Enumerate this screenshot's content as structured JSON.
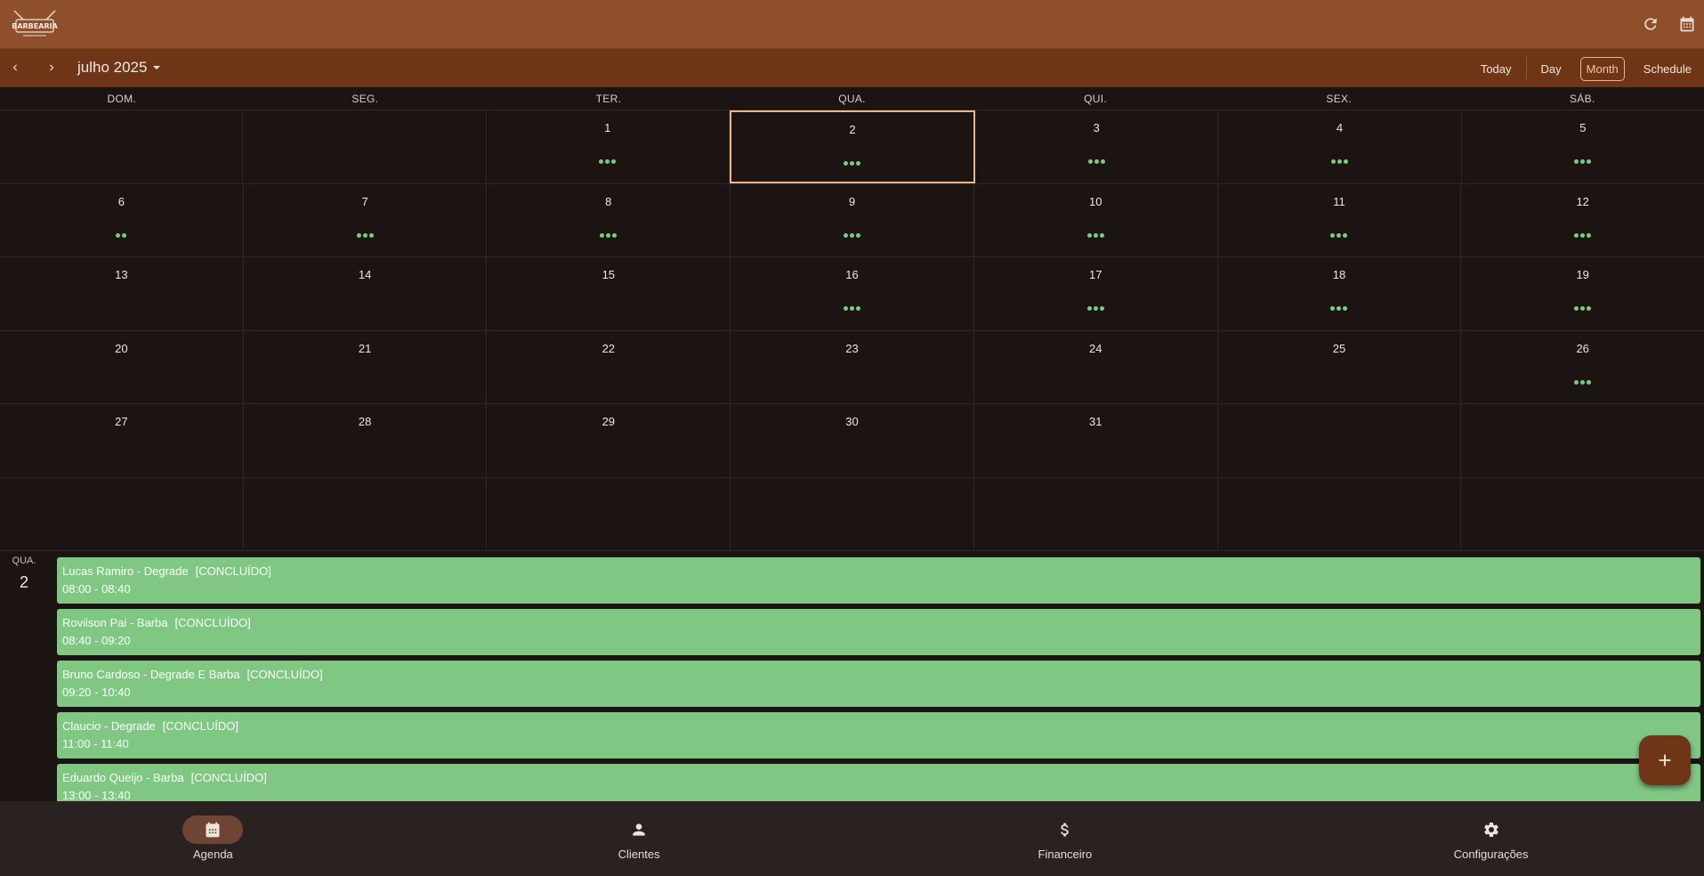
{
  "header": {
    "logo_text": "BARBEARIA",
    "icons": {
      "refresh": "refresh-icon",
      "calendar": "calendar-icon"
    }
  },
  "nav": {
    "month_label": "julho 2025",
    "views": [
      "Today",
      "Day",
      "Month",
      "Schedule"
    ],
    "active_view": "Month"
  },
  "calendar": {
    "weekdays": [
      "DOM.",
      "SEG.",
      "TER.",
      "QUA.",
      "QUI.",
      "SEX.",
      "SÁB."
    ],
    "weeks": [
      [
        {
          "d": "",
          "dots": 0
        },
        {
          "d": "",
          "dots": 0
        },
        {
          "d": "1",
          "dots": 3
        },
        {
          "d": "2",
          "dots": 3,
          "selected": true
        },
        {
          "d": "3",
          "dots": 3
        },
        {
          "d": "4",
          "dots": 3
        },
        {
          "d": "5",
          "dots": 3
        }
      ],
      [
        {
          "d": "6",
          "dots": 2
        },
        {
          "d": "7",
          "dots": 3
        },
        {
          "d": "8",
          "dots": 3
        },
        {
          "d": "9",
          "dots": 3
        },
        {
          "d": "10",
          "dots": 3
        },
        {
          "d": "11",
          "dots": 3
        },
        {
          "d": "12",
          "dots": 3
        }
      ],
      [
        {
          "d": "13",
          "dots": 0
        },
        {
          "d": "14",
          "dots": 0
        },
        {
          "d": "15",
          "dots": 0
        },
        {
          "d": "16",
          "dots": 3
        },
        {
          "d": "17",
          "dots": 3
        },
        {
          "d": "18",
          "dots": 3
        },
        {
          "d": "19",
          "dots": 3
        }
      ],
      [
        {
          "d": "20",
          "dots": 0
        },
        {
          "d": "21",
          "dots": 0
        },
        {
          "d": "22",
          "dots": 0
        },
        {
          "d": "23",
          "dots": 0
        },
        {
          "d": "24",
          "dots": 0
        },
        {
          "d": "25",
          "dots": 0
        },
        {
          "d": "26",
          "dots": 3
        }
      ],
      [
        {
          "d": "27",
          "dots": 0
        },
        {
          "d": "28",
          "dots": 0
        },
        {
          "d": "29",
          "dots": 0
        },
        {
          "d": "30",
          "dots": 0
        },
        {
          "d": "31",
          "dots": 0
        },
        {
          "d": "",
          "dots": 0
        },
        {
          "d": "",
          "dots": 0
        }
      ],
      [
        {
          "d": "",
          "dots": 0
        },
        {
          "d": "",
          "dots": 0
        },
        {
          "d": "",
          "dots": 0
        },
        {
          "d": "",
          "dots": 0
        },
        {
          "d": "",
          "dots": 0
        },
        {
          "d": "",
          "dots": 0
        },
        {
          "d": "",
          "dots": 0
        }
      ]
    ]
  },
  "agenda": {
    "dow": "QUA.",
    "day": "2",
    "events": [
      {
        "title": "Lucas Ramiro - Degrade",
        "status": "[CONCLUÍDO]",
        "time": "08:00 - 08:40"
      },
      {
        "title": "Rovilson Pai - Barba",
        "status": "[CONCLUÍDO]",
        "time": "08:40 - 09:20"
      },
      {
        "title": "Bruno Cardoso - Degrade E Barba",
        "status": "[CONCLUÍDO]",
        "time": "09:20 - 10:40"
      },
      {
        "title": "Claucio - Degrade",
        "status": "[CONCLUÍDO]",
        "time": "11:00 - 11:40"
      },
      {
        "title": "Eduardo Queijo - Barba",
        "status": "[CONCLUÍDO]",
        "time": "13:00 - 13:40"
      }
    ],
    "event_color": "#81c784"
  },
  "fab": {
    "icon": "plus-icon"
  },
  "bottom_nav": {
    "items": [
      {
        "label": "Agenda",
        "icon": "calendar-icon",
        "active": true
      },
      {
        "label": "Clientes",
        "icon": "person-icon",
        "active": false
      },
      {
        "label": "Financeiro",
        "icon": "dollar-icon",
        "active": false
      },
      {
        "label": "Configurações",
        "icon": "gear-icon",
        "active": false
      }
    ]
  },
  "colors": {
    "header": "#8f4f2a",
    "navbar": "#6e3516",
    "background": "#1b1412",
    "accent": "#f0b48a",
    "event_green": "#81c784"
  }
}
